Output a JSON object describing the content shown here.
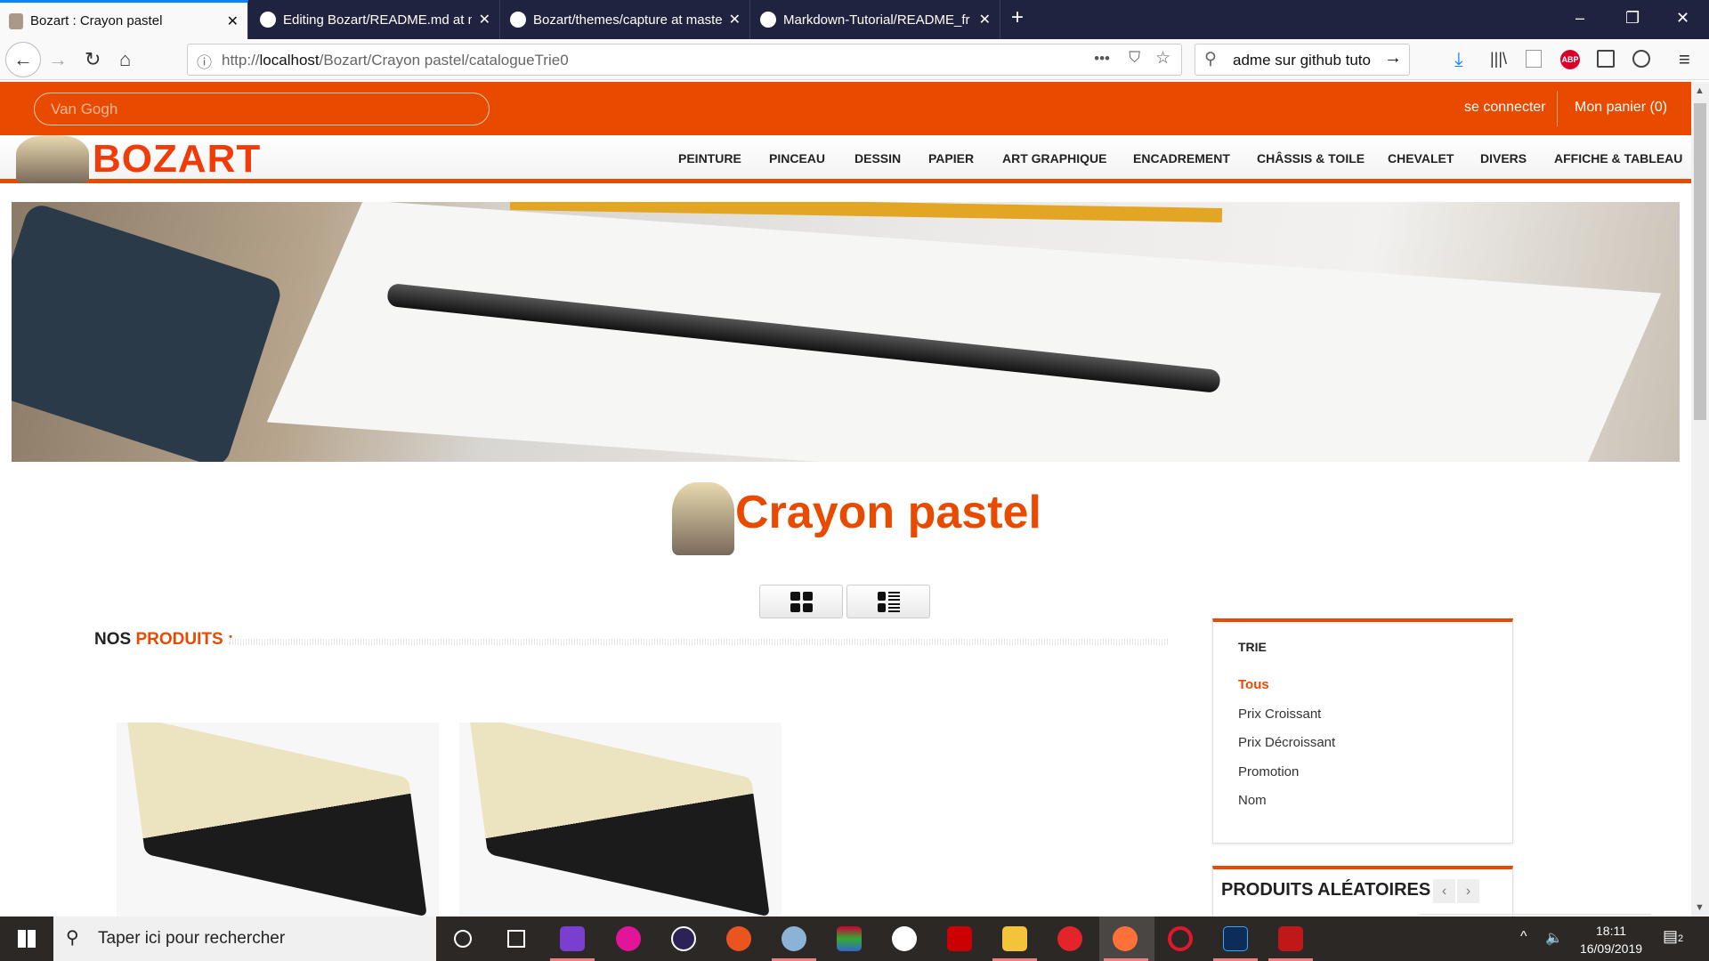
{
  "browser": {
    "tabs": [
      {
        "title": "Bozart : Crayon pastel",
        "active": true
      },
      {
        "title": "Editing Bozart/README.md at master"
      },
      {
        "title": "Bozart/themes/capture at master"
      },
      {
        "title": "Markdown-Tutorial/README_fr"
      }
    ],
    "url_prefix": "http://",
    "url_host": "localhost",
    "url_path": "/Bozart/Crayon pastel/catalogueTrie0",
    "search_value": "adme sur github tuto"
  },
  "site": {
    "search_placeholder": "Van Gogh",
    "login": "se connecter",
    "cart": "Mon panier (0)",
    "logo": "BOZART",
    "menu": [
      "PEINTURE",
      "PINCEAU",
      "DESSIN",
      "PAPIER",
      "ART GRAPHIQUE",
      "ENCADREMENT",
      "CHÂSSIS & TOILE",
      "CHEVALET",
      "DIVERS",
      "AFFICHE & TABLEAU"
    ],
    "page_title": "Crayon pastel",
    "products_heading_a": "NOS",
    "products_heading_b": "PRODUITS :",
    "sort": {
      "title": "TRIE",
      "items": [
        "Tous",
        "Prix Croissant",
        "Prix Décroissant",
        "Promotion",
        "Nom"
      ],
      "active": 0
    },
    "random_title": "PRODUITS ALÉATOIRES",
    "accent": "#e84a00"
  },
  "taskbar": {
    "search": "Taper ici pour rechercher",
    "time": "18:11",
    "date": "16/09/2019",
    "notif": "2"
  }
}
